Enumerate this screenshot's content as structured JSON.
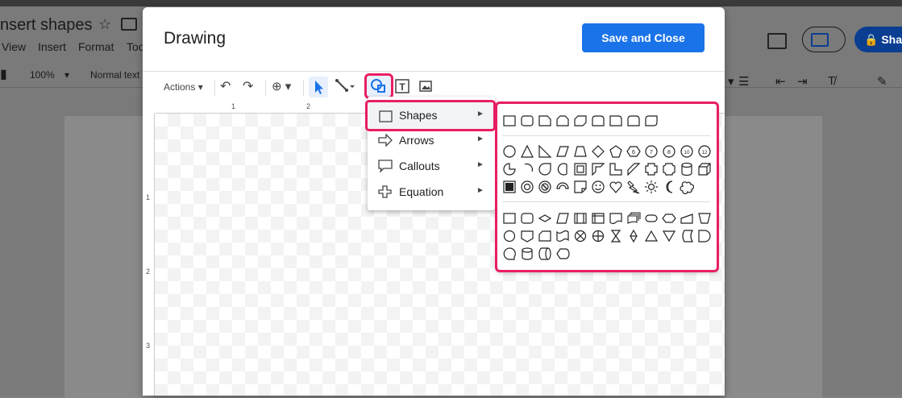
{
  "background": {
    "doc_title": "nsert shapes",
    "menu": [
      "View",
      "Insert",
      "Format",
      "Too"
    ],
    "toolbar": {
      "zoom": "100%",
      "style": "Normal text",
      "share": "Sha"
    }
  },
  "dialog": {
    "title": "Drawing",
    "save_label": "Save and Close",
    "toolbar": {
      "actions_label": "Actions"
    },
    "ruler": {
      "top": [
        "1",
        "2"
      ],
      "left": [
        "1",
        "2",
        "3"
      ]
    }
  },
  "shape_menu": {
    "items": [
      {
        "label": "Shapes",
        "icon": "square-icon"
      },
      {
        "label": "Arrows",
        "icon": "arrow-icon"
      },
      {
        "label": "Callouts",
        "icon": "callout-icon"
      },
      {
        "label": "Equation",
        "icon": "plus-icon"
      }
    ]
  },
  "colors": {
    "accent": "#1a73e8",
    "highlight": "#e91e63"
  }
}
